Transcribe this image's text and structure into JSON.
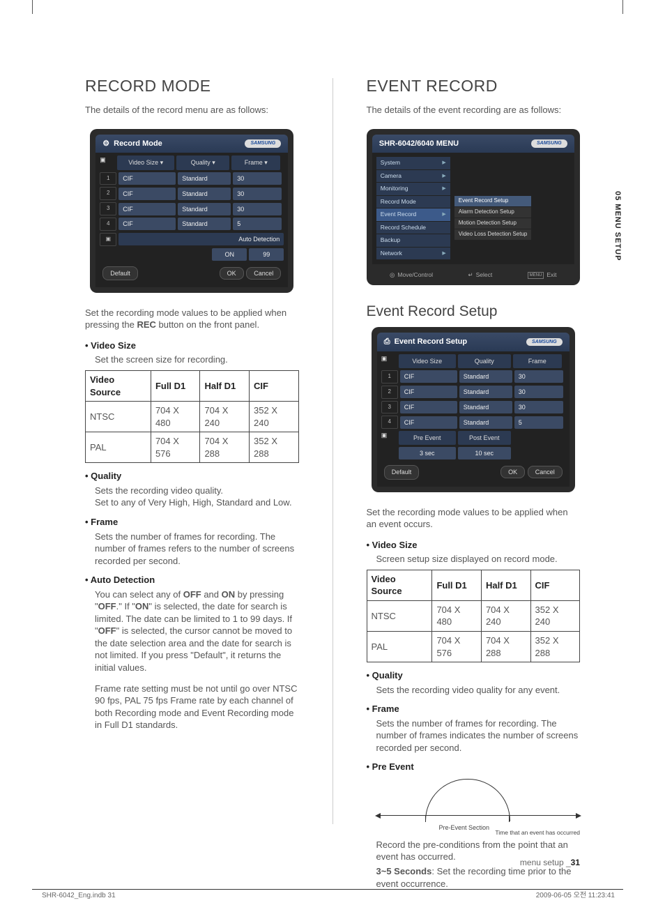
{
  "sideTab": "05 MENU SETUP",
  "footer": {
    "left": "SHR-6042_Eng.indb   31",
    "right": "2009-06-05   오전 11:23:41",
    "pageLabel": "menu setup _",
    "pageNo": "31"
  },
  "left": {
    "title": "RECORD MODE",
    "intro": "The details of the record menu are as follows:",
    "panel": {
      "title": "Record Mode",
      "brand": "SAMSUNG",
      "cols": {
        "videoSize": "Video Size ▾",
        "quality": "Quality ▾",
        "frame": "Frame ▾"
      },
      "rows": [
        {
          "ch": "1",
          "size": "CIF",
          "quality": "Standard",
          "frame": "30"
        },
        {
          "ch": "2",
          "size": "CIF",
          "quality": "Standard",
          "frame": "30"
        },
        {
          "ch": "3",
          "size": "CIF",
          "quality": "Standard",
          "frame": "30"
        },
        {
          "ch": "4",
          "size": "CIF",
          "quality": "Standard",
          "frame": "5"
        }
      ],
      "autoDetection": "Auto Detection",
      "autoOn": "ON",
      "autoDays": "99",
      "btnDefault": "Default",
      "btnOK": "OK",
      "btnCancel": "Cancel"
    },
    "para_setMode_a": "Set the recording mode values to be applied when pressing the ",
    "para_setMode_b": "REC",
    "para_setMode_c": " button on the front panel.",
    "bullets": {
      "videoSize": {
        "head": "Video Size",
        "body": "Set the screen size for recording."
      },
      "quality": {
        "head": "Quality",
        "body1": "Sets the recording video quality.",
        "body2": "Set to any of Very High, High, Standard and Low."
      },
      "frame": {
        "head": "Frame",
        "body": "Sets the number of frames for recording. The number of frames refers to the number of screens recorded per second."
      },
      "autoDet": {
        "head": "Auto Detection",
        "body_a": "You can select any of ",
        "b_off": "OFF",
        "body_b": " and ",
        "b_on": "ON",
        "body_c": " by pressing \"",
        "b_off2": "OFF",
        "body_d": ".\" If \"",
        "b_on2": "ON",
        "body_e": "\" is selected, the date for search is limited. The date can be limited to 1 to 99 days. If \"",
        "b_off3": "OFF",
        "body_f": "\" is selected, the cursor cannot be moved to the date selection area and the date for search is not limited. If you press \"Default\", it returns the initial values.",
        "body_g": "Frame rate setting must be not until go over NTSC 90 fps, PAL 75 fps Frame rate by each channel of both Recording mode and Event Recording mode in Full D1 standards."
      }
    },
    "resTable": {
      "head": {
        "c0": "Video Source",
        "c1": "Full D1",
        "c2": "Half D1",
        "c3": "CIF"
      },
      "rows": [
        {
          "c0": "NTSC",
          "c1": "704 X 480",
          "c2": "704 X 240",
          "c3": "352 X 240"
        },
        {
          "c0": "PAL",
          "c1": "704 X 576",
          "c2": "704 X 288",
          "c3": "352 X 288"
        }
      ]
    }
  },
  "right": {
    "title": "EVENT RECORD",
    "intro": "The details of the event recording are as follows:",
    "menuPanel": {
      "title": "SHR-6042/6040 MENU",
      "brand": "SAMSUNG",
      "items": [
        "System",
        "Camera",
        "Monitoring",
        "Record Mode",
        "Event Record",
        "Record Schedule",
        "Backup",
        "Network"
      ],
      "submenu": [
        "Event Record Setup",
        "Alarm Detection Setup",
        "Motion Detection Setup",
        "Video Loss Detection Setup"
      ],
      "footer": {
        "move": "Move/Control",
        "select": "Select",
        "exit": "Exit",
        "exitKey": "MENU"
      }
    },
    "subTitle": "Event Record Setup",
    "panel": {
      "title": "Event Record Setup",
      "brand": "SAMSUNG",
      "cols": {
        "videoSize": "Video Size",
        "quality": "Quality",
        "frame": "Frame"
      },
      "rows": [
        {
          "ch": "1",
          "size": "CIF",
          "quality": "Standard",
          "frame": "30"
        },
        {
          "ch": "2",
          "size": "CIF",
          "quality": "Standard",
          "frame": "30"
        },
        {
          "ch": "3",
          "size": "CIF",
          "quality": "Standard",
          "frame": "30"
        },
        {
          "ch": "4",
          "size": "CIF",
          "quality": "Standard",
          "frame": "5"
        }
      ],
      "preHead": "Pre Event",
      "postHead": "Post Event",
      "preVal": "3 sec",
      "postVal": "10 sec",
      "btnDefault": "Default",
      "btnOK": "OK",
      "btnCancel": "Cancel"
    },
    "para_setMode": "Set the recording mode values to be applied when an event occurs.",
    "bullets": {
      "videoSize": {
        "head": "Video Size",
        "body": "Screen setup size displayed on record mode."
      },
      "quality": {
        "head": "Quality",
        "body": "Sets the recording video quality for any event."
      },
      "frame": {
        "head": "Frame",
        "body": "Sets the number of frames for recording. The number of frames indicates the number of screens recorded per second."
      },
      "preEvent": {
        "head": "Pre Event",
        "lblPre": "Pre-Event Section",
        "lblTime": "Time that an event has occurred",
        "body1": "Record the pre-conditions from the point that an event has occurred.",
        "body2a": "3~5 Seconds",
        "body2b": ": Set the recording time prior to the event occurrence."
      }
    },
    "resTable": {
      "head": {
        "c0": "Video Source",
        "c1": "Full D1",
        "c2": "Half D1",
        "c3": "CIF"
      },
      "rows": [
        {
          "c0": "NTSC",
          "c1": "704 X 480",
          "c2": "704 X 240",
          "c3": "352 X 240"
        },
        {
          "c0": "PAL",
          "c1": "704 X 576",
          "c2": "704 X 288",
          "c3": "352 X 288"
        }
      ]
    }
  }
}
